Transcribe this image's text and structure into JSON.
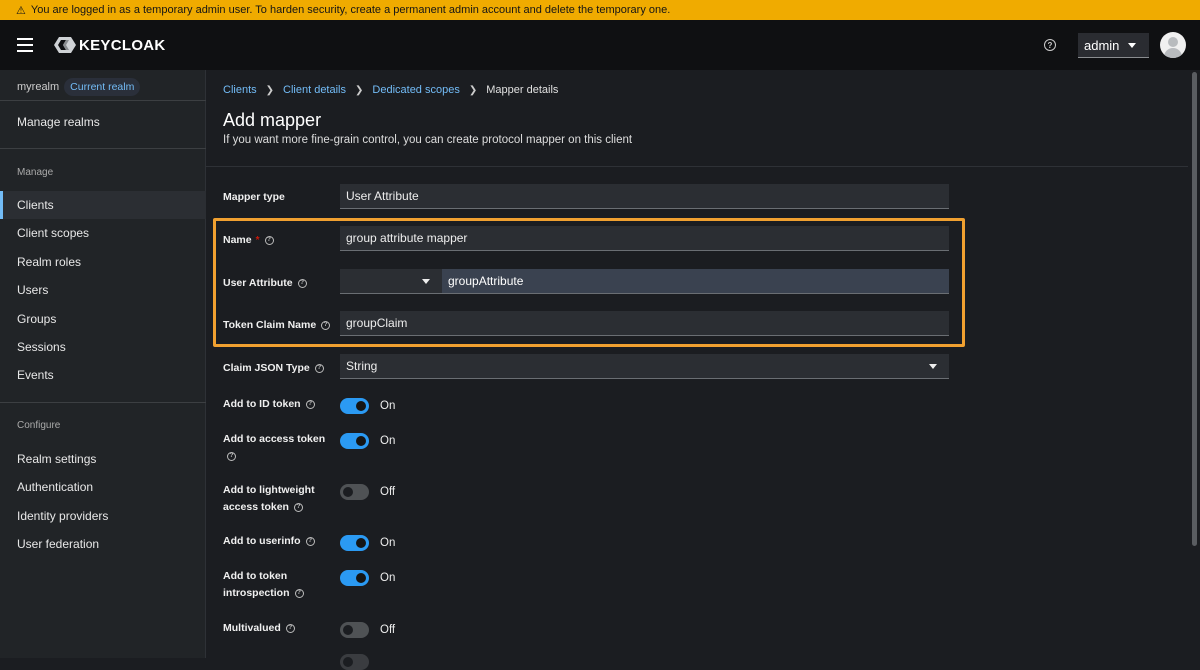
{
  "banner": {
    "text": "You are logged in as a temporary admin user. To harden security, create a permanent admin account and delete the temporary one."
  },
  "header": {
    "brand": "KEYCLOAK",
    "user": "admin",
    "colors": {
      "banner": "#f0ab00",
      "accent": "#73bcf7",
      "toggle_on": "#2b9af3",
      "highlight": "#f0a030"
    }
  },
  "sidebar": {
    "realm": "myrealm",
    "realm_badge": "Current realm",
    "manage_realms": "Manage realms",
    "manage_section": "Manage",
    "manage_items": [
      "Clients",
      "Client scopes",
      "Realm roles",
      "Users",
      "Groups",
      "Sessions",
      "Events"
    ],
    "active_item": "Clients",
    "configure_section": "Configure",
    "configure_items": [
      "Realm settings",
      "Authentication",
      "Identity providers",
      "User federation"
    ]
  },
  "breadcrumb": [
    "Clients",
    "Client details",
    "Dedicated scopes",
    "Mapper details"
  ],
  "page": {
    "title": "Add mapper",
    "subtitle": "If you want more fine-grain control, you can create protocol mapper on this client"
  },
  "form": {
    "mapper_type_label": "Mapper type",
    "mapper_type_value": "User Attribute",
    "name_label": "Name",
    "name_required": "*",
    "name_value": "group attribute mapper",
    "user_attribute_label": "User Attribute",
    "user_attribute_select": "",
    "user_attribute_value": "groupAttribute",
    "token_claim_label": "Token Claim Name",
    "token_claim_value": "groupClaim",
    "claim_json_label": "Claim JSON Type",
    "claim_json_value": "String",
    "toggles": [
      {
        "label_line1": "Add to ID token",
        "label_line2": "",
        "state": "On",
        "on": true
      },
      {
        "label_line1": "Add to access token",
        "label_line2": "",
        "state": "On",
        "on": true
      },
      {
        "label_line1": "Add to lightweight",
        "label_line2": "access token",
        "state": "Off",
        "on": false
      },
      {
        "label_line1": "Add to userinfo",
        "label_line2": "",
        "state": "On",
        "on": true
      },
      {
        "label_line1": "Add to token",
        "label_line2": "introspection",
        "state": "On",
        "on": true
      },
      {
        "label_line1": "Multivalued",
        "label_line2": "",
        "state": "Off",
        "on": false
      }
    ]
  }
}
